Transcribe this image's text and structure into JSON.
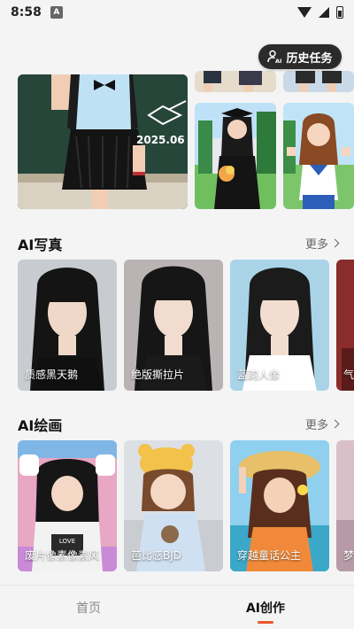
{
  "status_bar": {
    "time": "8:58",
    "notification_badge": "A"
  },
  "history_button": {
    "label": "历史任务"
  },
  "banner": {
    "date_text": "2025.06"
  },
  "section_photo": {
    "title": "AI写真",
    "more": "更多",
    "cards": [
      {
        "label": "质感黑天鹅"
      },
      {
        "label": "绝版撕拉片"
      },
      {
        "label": "蓝韵人像"
      },
      {
        "label": "气"
      }
    ]
  },
  "section_paint": {
    "title": "AI绘画",
    "more": "更多",
    "cards": [
      {
        "label": "废片像素像素风"
      },
      {
        "label": "芭比感BJD"
      },
      {
        "label": "穿越童话公主"
      },
      {
        "label": "梦"
      }
    ]
  },
  "bottom_nav": {
    "home": "首页",
    "ai_create": "AI创作"
  },
  "colors": {
    "accent": "#e9572b",
    "dark_button": "#2b2b2b"
  }
}
